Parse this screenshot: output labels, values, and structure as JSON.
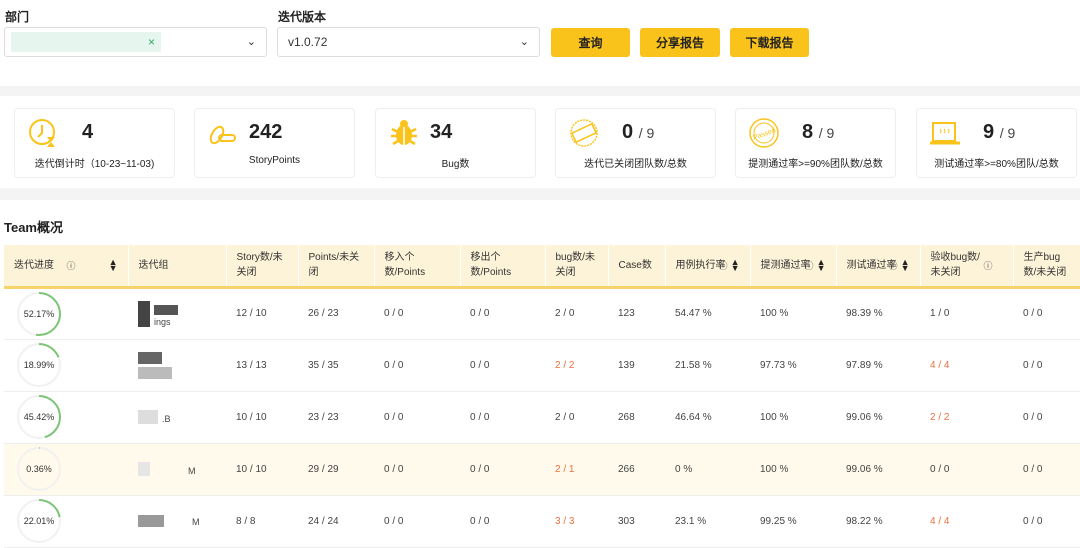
{
  "filters": {
    "dept_label": "部门",
    "dept_tag_remove": "×",
    "version_label": "迭代版本",
    "version_value": "v1.0.72",
    "query": "查询",
    "share": "分享报告",
    "download": "下载报告"
  },
  "cards": [
    {
      "icon": "clock-hourglass-icon",
      "value": "4",
      "label": "迭代倒计时（10-23~11-03)"
    },
    {
      "icon": "coins-icon",
      "value": "242",
      "label": "StoryPoints"
    },
    {
      "icon": "bug-icon",
      "value": "34",
      "label": "Bug数"
    },
    {
      "icon": "closed-stamp-icon",
      "value": "0",
      "total": "/ 9",
      "label": "迭代已关闭团队数/总数"
    },
    {
      "icon": "passed-stamp-icon",
      "value": "8",
      "total": "/ 9",
      "label": "提测通过率>=90%团队数/总数"
    },
    {
      "icon": "laptop-icon",
      "value": "9",
      "total": "/ 9",
      "label": "测试通过率>=80%团队/总数"
    }
  ],
  "section_title": "Team概况",
  "headers": [
    "迭代进度",
    "迭代组",
    "Story数/未关闭",
    "Points/未关闭",
    "移入个数/Points",
    "移出个数/Points",
    "bug数/未关闭",
    "Case数",
    "用例执行率",
    "提测通过率",
    "测试通过率",
    "验收bug数/未关闭",
    "生产bug数/未关闭"
  ],
  "colors": {
    "accent": "#f9c31c",
    "progress": "#7cc576",
    "warn": "#f0703e"
  },
  "rows": [
    {
      "progress": 52.17,
      "progress_label": "52.17%",
      "team": "ings",
      "story": "12 / 10",
      "points": "26 / 23",
      "in": "0 / 0",
      "out": "0 / 0",
      "bug": "2 / 0",
      "bug_warn": false,
      "case": "123",
      "exec": "54.47 %",
      "submit": "100 %",
      "test": "98.39 %",
      "accept": "1 / 0",
      "accept_warn": false,
      "prod": "0 / 0"
    },
    {
      "progress": 18.99,
      "progress_label": "18.99%",
      "team": "",
      "story": "13 / 13",
      "points": "35 / 35",
      "in": "0 / 0",
      "out": "0 / 0",
      "bug": "2 / 2",
      "bug_warn": true,
      "case": "139",
      "exec": "21.58 %",
      "submit": "97.73 %",
      "test": "97.89 %",
      "accept": "4 / 4",
      "accept_warn": true,
      "prod": "0 / 0"
    },
    {
      "progress": 45.42,
      "progress_label": "45.42%",
      "team": ".B",
      "story": "10 / 10",
      "points": "23 / 23",
      "in": "0 / 0",
      "out": "0 / 0",
      "bug": "2 / 0",
      "bug_warn": false,
      "case": "268",
      "exec": "46.64 %",
      "submit": "100 %",
      "test": "99.06 %",
      "accept": "2 / 2",
      "accept_warn": true,
      "prod": "0 / 0"
    },
    {
      "progress": 0.36,
      "progress_label": "0.36%",
      "team": "M",
      "story": "10 / 10",
      "points": "29 / 29",
      "in": "0 / 0",
      "out": "0 / 0",
      "bug": "2 / 1",
      "bug_warn": true,
      "case": "266",
      "exec": "0 %",
      "submit": "100 %",
      "test": "99.06 %",
      "accept": "0 / 0",
      "accept_warn": false,
      "prod": "0 / 0"
    },
    {
      "progress": 22.01,
      "progress_label": "22.01%",
      "team": "M",
      "story": "8 / 8",
      "points": "24 / 24",
      "in": "0 / 0",
      "out": "0 / 0",
      "bug": "3 / 3",
      "bug_warn": true,
      "case": "303",
      "exec": "23.1 %",
      "submit": "99.25 %",
      "test": "98.22 %",
      "accept": "4 / 4",
      "accept_warn": true,
      "prod": "0 / 0"
    }
  ]
}
